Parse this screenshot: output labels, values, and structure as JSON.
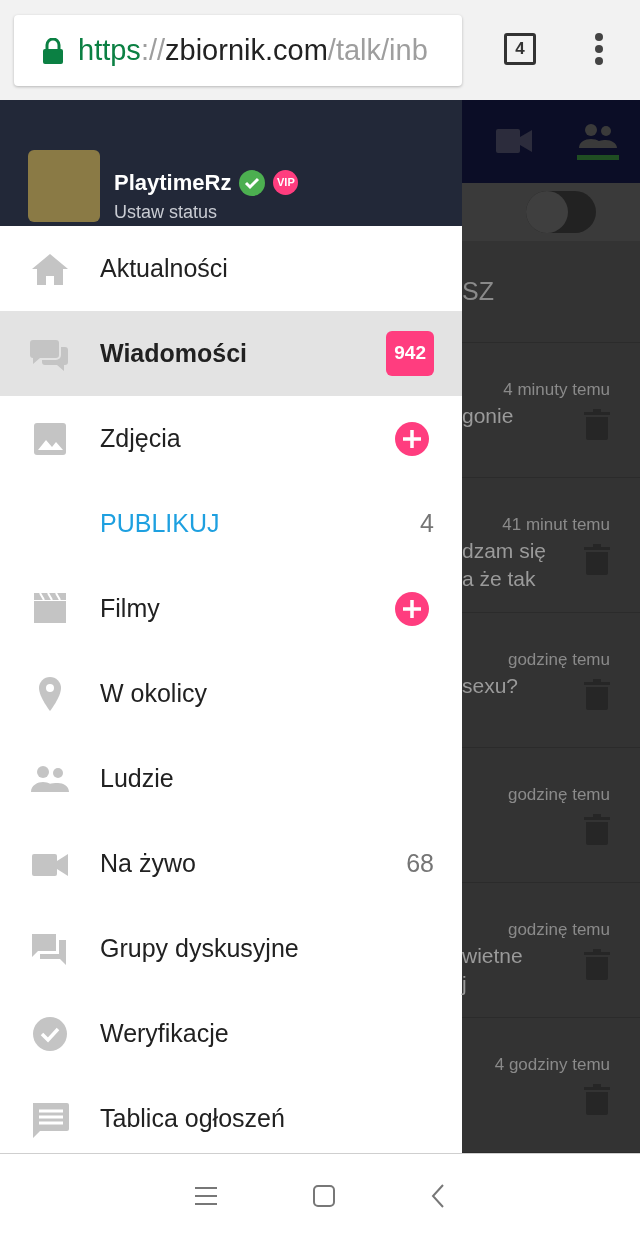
{
  "browser": {
    "url": [
      {
        "kind": "scheme",
        "text": "https"
      },
      {
        "kind": "sep",
        "text": "://"
      },
      {
        "kind": "host",
        "text": "zbiornik.com"
      },
      {
        "kind": "path",
        "text": "/talk/inb"
      }
    ],
    "tab_count": "4"
  },
  "profile": {
    "name": "PlaytimeRz",
    "verified": true,
    "vip": "VIP",
    "status": "Ustaw status"
  },
  "menu": [
    {
      "kind": "nav",
      "label": "Aktualności",
      "selected": false
    },
    {
      "kind": "nav",
      "label": "Wiadomości",
      "selected": true,
      "badge": "942"
    },
    {
      "kind": "nav",
      "label": "Zdjęcia",
      "selected": false,
      "add": true
    },
    {
      "kind": "sub",
      "label": "PUBLIKUJ",
      "selected": false,
      "count": "4"
    },
    {
      "kind": "nav",
      "label": "Filmy",
      "selected": false,
      "add": true
    },
    {
      "kind": "nav",
      "label": "W okolicy",
      "selected": false
    },
    {
      "kind": "nav",
      "label": "Ludzie",
      "selected": false
    },
    {
      "kind": "nav",
      "label": "Na żywo",
      "selected": false,
      "count": "68"
    },
    {
      "kind": "nav",
      "label": "Grupy dyskusyjne",
      "selected": false
    },
    {
      "kind": "nav",
      "label": "Weryfikacje",
      "selected": false
    },
    {
      "kind": "nav",
      "label": "Tablica ogłoszeń",
      "selected": false
    }
  ],
  "background": {
    "toggle": {
      "on": false
    },
    "heading": "SZ",
    "messages": [
      {
        "time": "4 minuty temu",
        "lines": [
          "gonie"
        ]
      },
      {
        "time": "41 minut temu",
        "lines": [
          "dzam się",
          "a że tak"
        ]
      },
      {
        "time": "godzinę temu",
        "lines": [
          "sexu?"
        ]
      },
      {
        "time": "godzinę temu"
      },
      {
        "time": "godzinę temu",
        "lines": [
          "wietne",
          "j"
        ]
      },
      {
        "time": "4 godziny temu"
      }
    ]
  }
}
